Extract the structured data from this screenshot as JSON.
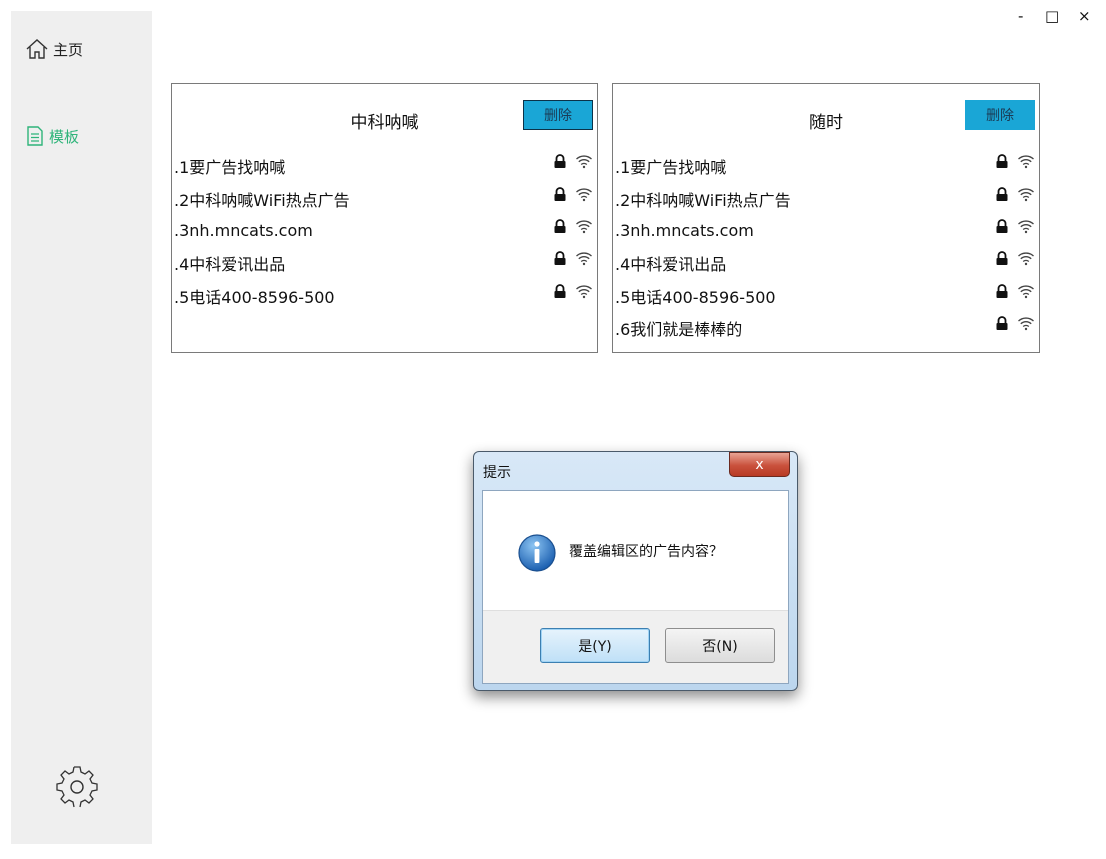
{
  "window_controls": {
    "minimize": "-",
    "maximize": "□",
    "close": "×"
  },
  "sidebar": {
    "items": [
      {
        "label": "主页",
        "icon": "home-icon"
      },
      {
        "label": "模板",
        "icon": "document-icon",
        "active": true
      }
    ],
    "settings_icon": "gear-icon"
  },
  "colors": {
    "active": "#2fb47a",
    "delete_button": "#1aa6d6"
  },
  "templates": [
    {
      "title": "中科呐喊",
      "delete_label": "删除",
      "rows": [
        ".1要广告找呐喊",
        ".2中科呐喊WiFi热点广告",
        ".3nh.mncats.com",
        ".4中科爱讯出品",
        ".5电话400-8596-500"
      ]
    },
    {
      "title": "随时",
      "delete_label": "删除",
      "rows": [
        ".1要广告找呐喊",
        ".2中科呐喊WiFi热点广告",
        ".3nh.mncats.com",
        ".4中科爱讯出品",
        ".5电话400-8596-500",
        ".6我们就是棒棒的"
      ]
    }
  ],
  "dialog": {
    "title": "提示",
    "close_label": "x",
    "message": "覆盖编辑区的广告内容？",
    "yes_label": "是(Y)",
    "no_label": "否(N)",
    "icon": "info-icon"
  }
}
